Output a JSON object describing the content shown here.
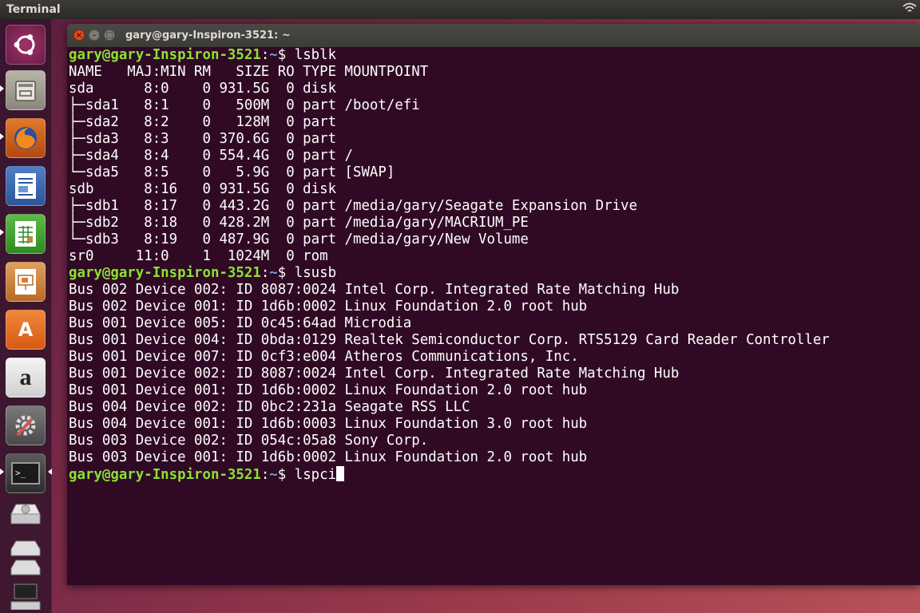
{
  "top_panel": {
    "app_name": "Terminal"
  },
  "launcher": {
    "items": [
      {
        "name": "ubuntu-dash",
        "glyph": ""
      },
      {
        "name": "files",
        "glyph": ""
      },
      {
        "name": "firefox",
        "glyph": ""
      },
      {
        "name": "libreoffice-writer",
        "glyph": ""
      },
      {
        "name": "libreoffice-calc",
        "glyph": ""
      },
      {
        "name": "libreoffice-impress",
        "glyph": ""
      },
      {
        "name": "ubuntu-software",
        "glyph": "A"
      },
      {
        "name": "amazon",
        "glyph": "a"
      },
      {
        "name": "system-settings",
        "glyph": ""
      },
      {
        "name": "terminal",
        "glyph": ">_"
      },
      {
        "name": "drive",
        "glyph": ""
      },
      {
        "name": "drive-stack",
        "glyph": ""
      }
    ]
  },
  "window": {
    "title": "gary@gary-Inspiron-3521: ~",
    "close_label": "×",
    "min_label": "–",
    "max_label": "□"
  },
  "terminal": {
    "prompt_user": "gary@gary-Inspiron-3521",
    "prompt_path": "~",
    "prompt_sep": ":",
    "prompt_end": "$ ",
    "commands": [
      "lsblk",
      "lsusb",
      "lspci"
    ],
    "lsblk_output": [
      "NAME   MAJ:MIN RM   SIZE RO TYPE MOUNTPOINT",
      "sda      8:0    0 931.5G  0 disk ",
      "├─sda1   8:1    0   500M  0 part /boot/efi",
      "├─sda2   8:2    0   128M  0 part ",
      "├─sda3   8:3    0 370.6G  0 part ",
      "├─sda4   8:4    0 554.4G  0 part /",
      "└─sda5   8:5    0   5.9G  0 part [SWAP]",
      "sdb      8:16   0 931.5G  0 disk ",
      "├─sdb1   8:17   0 443.2G  0 part /media/gary/Seagate Expansion Drive",
      "├─sdb2   8:18   0 428.2M  0 part /media/gary/MACRIUM_PE",
      "└─sdb3   8:19   0 487.9G  0 part /media/gary/New Volume",
      "sr0     11:0    1  1024M  0 rom  "
    ],
    "lsusb_output": [
      "Bus 002 Device 002: ID 8087:0024 Intel Corp. Integrated Rate Matching Hub",
      "Bus 002 Device 001: ID 1d6b:0002 Linux Foundation 2.0 root hub",
      "Bus 001 Device 005: ID 0c45:64ad Microdia",
      "Bus 001 Device 004: ID 0bda:0129 Realtek Semiconductor Corp. RTS5129 Card Reader Controller",
      "Bus 001 Device 007: ID 0cf3:e004 Atheros Communications, Inc.",
      "Bus 001 Device 002: ID 8087:0024 Intel Corp. Integrated Rate Matching Hub",
      "Bus 001 Device 001: ID 1d6b:0002 Linux Foundation 2.0 root hub",
      "Bus 004 Device 002: ID 0bc2:231a Seagate RSS LLC",
      "Bus 004 Device 001: ID 1d6b:0003 Linux Foundation 3.0 root hub",
      "Bus 003 Device 002: ID 054c:05a8 Sony Corp.",
      "Bus 003 Device 001: ID 1d6b:0002 Linux Foundation 2.0 root hub"
    ]
  }
}
